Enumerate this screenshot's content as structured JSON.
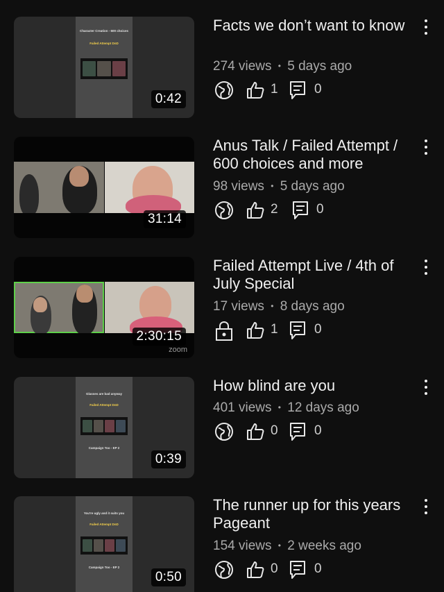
{
  "videos": [
    {
      "title": "Facts we don’t want to know",
      "views": "274 views",
      "age": "5 days ago",
      "duration": "0:42",
      "likes": "1",
      "comments": "0",
      "visibility_icon": "globe-icon",
      "thumb_caption": "Character Creation - 600 choices",
      "thumb_sub": "Failed Attempt DnD",
      "thumb_footer": ""
    },
    {
      "title": "Anus Talk / Failed Attempt / 600 choices and more",
      "views": "98 views",
      "age": "5 days ago",
      "duration": "31:14",
      "likes": "2",
      "comments": "0",
      "visibility_icon": "globe-icon"
    },
    {
      "title": "Failed Attempt Live / 4th of July Special",
      "views": "17 views",
      "age": "8 days ago",
      "duration": "2:30:15",
      "likes": "1",
      "comments": "0",
      "visibility_icon": "lock-icon",
      "watermark": "zoom"
    },
    {
      "title": "How blind are you",
      "views": "401 views",
      "age": "12 days ago",
      "duration": "0:39",
      "likes": "0",
      "comments": "0",
      "visibility_icon": "globe-icon",
      "thumb_caption": "Glasses are bad anyway",
      "thumb_sub": "Failed Attempt DnD",
      "thumb_footer": "Campaign Too - EP 2"
    },
    {
      "title": "The runner up for this years Pageant",
      "views": "154 views",
      "age": "2 weeks ago",
      "duration": "0:50",
      "likes": "0",
      "comments": "0",
      "visibility_icon": "globe-icon",
      "thumb_caption": "You're ugly and it suits you",
      "thumb_sub": "Failed Attempt DnD",
      "thumb_footer": "Campaign Too - EP 2"
    }
  ],
  "separator": "•",
  "colors": {
    "background": "#0f0f0f",
    "text": "#f1f1f1",
    "meta": "#aaaaaa"
  }
}
